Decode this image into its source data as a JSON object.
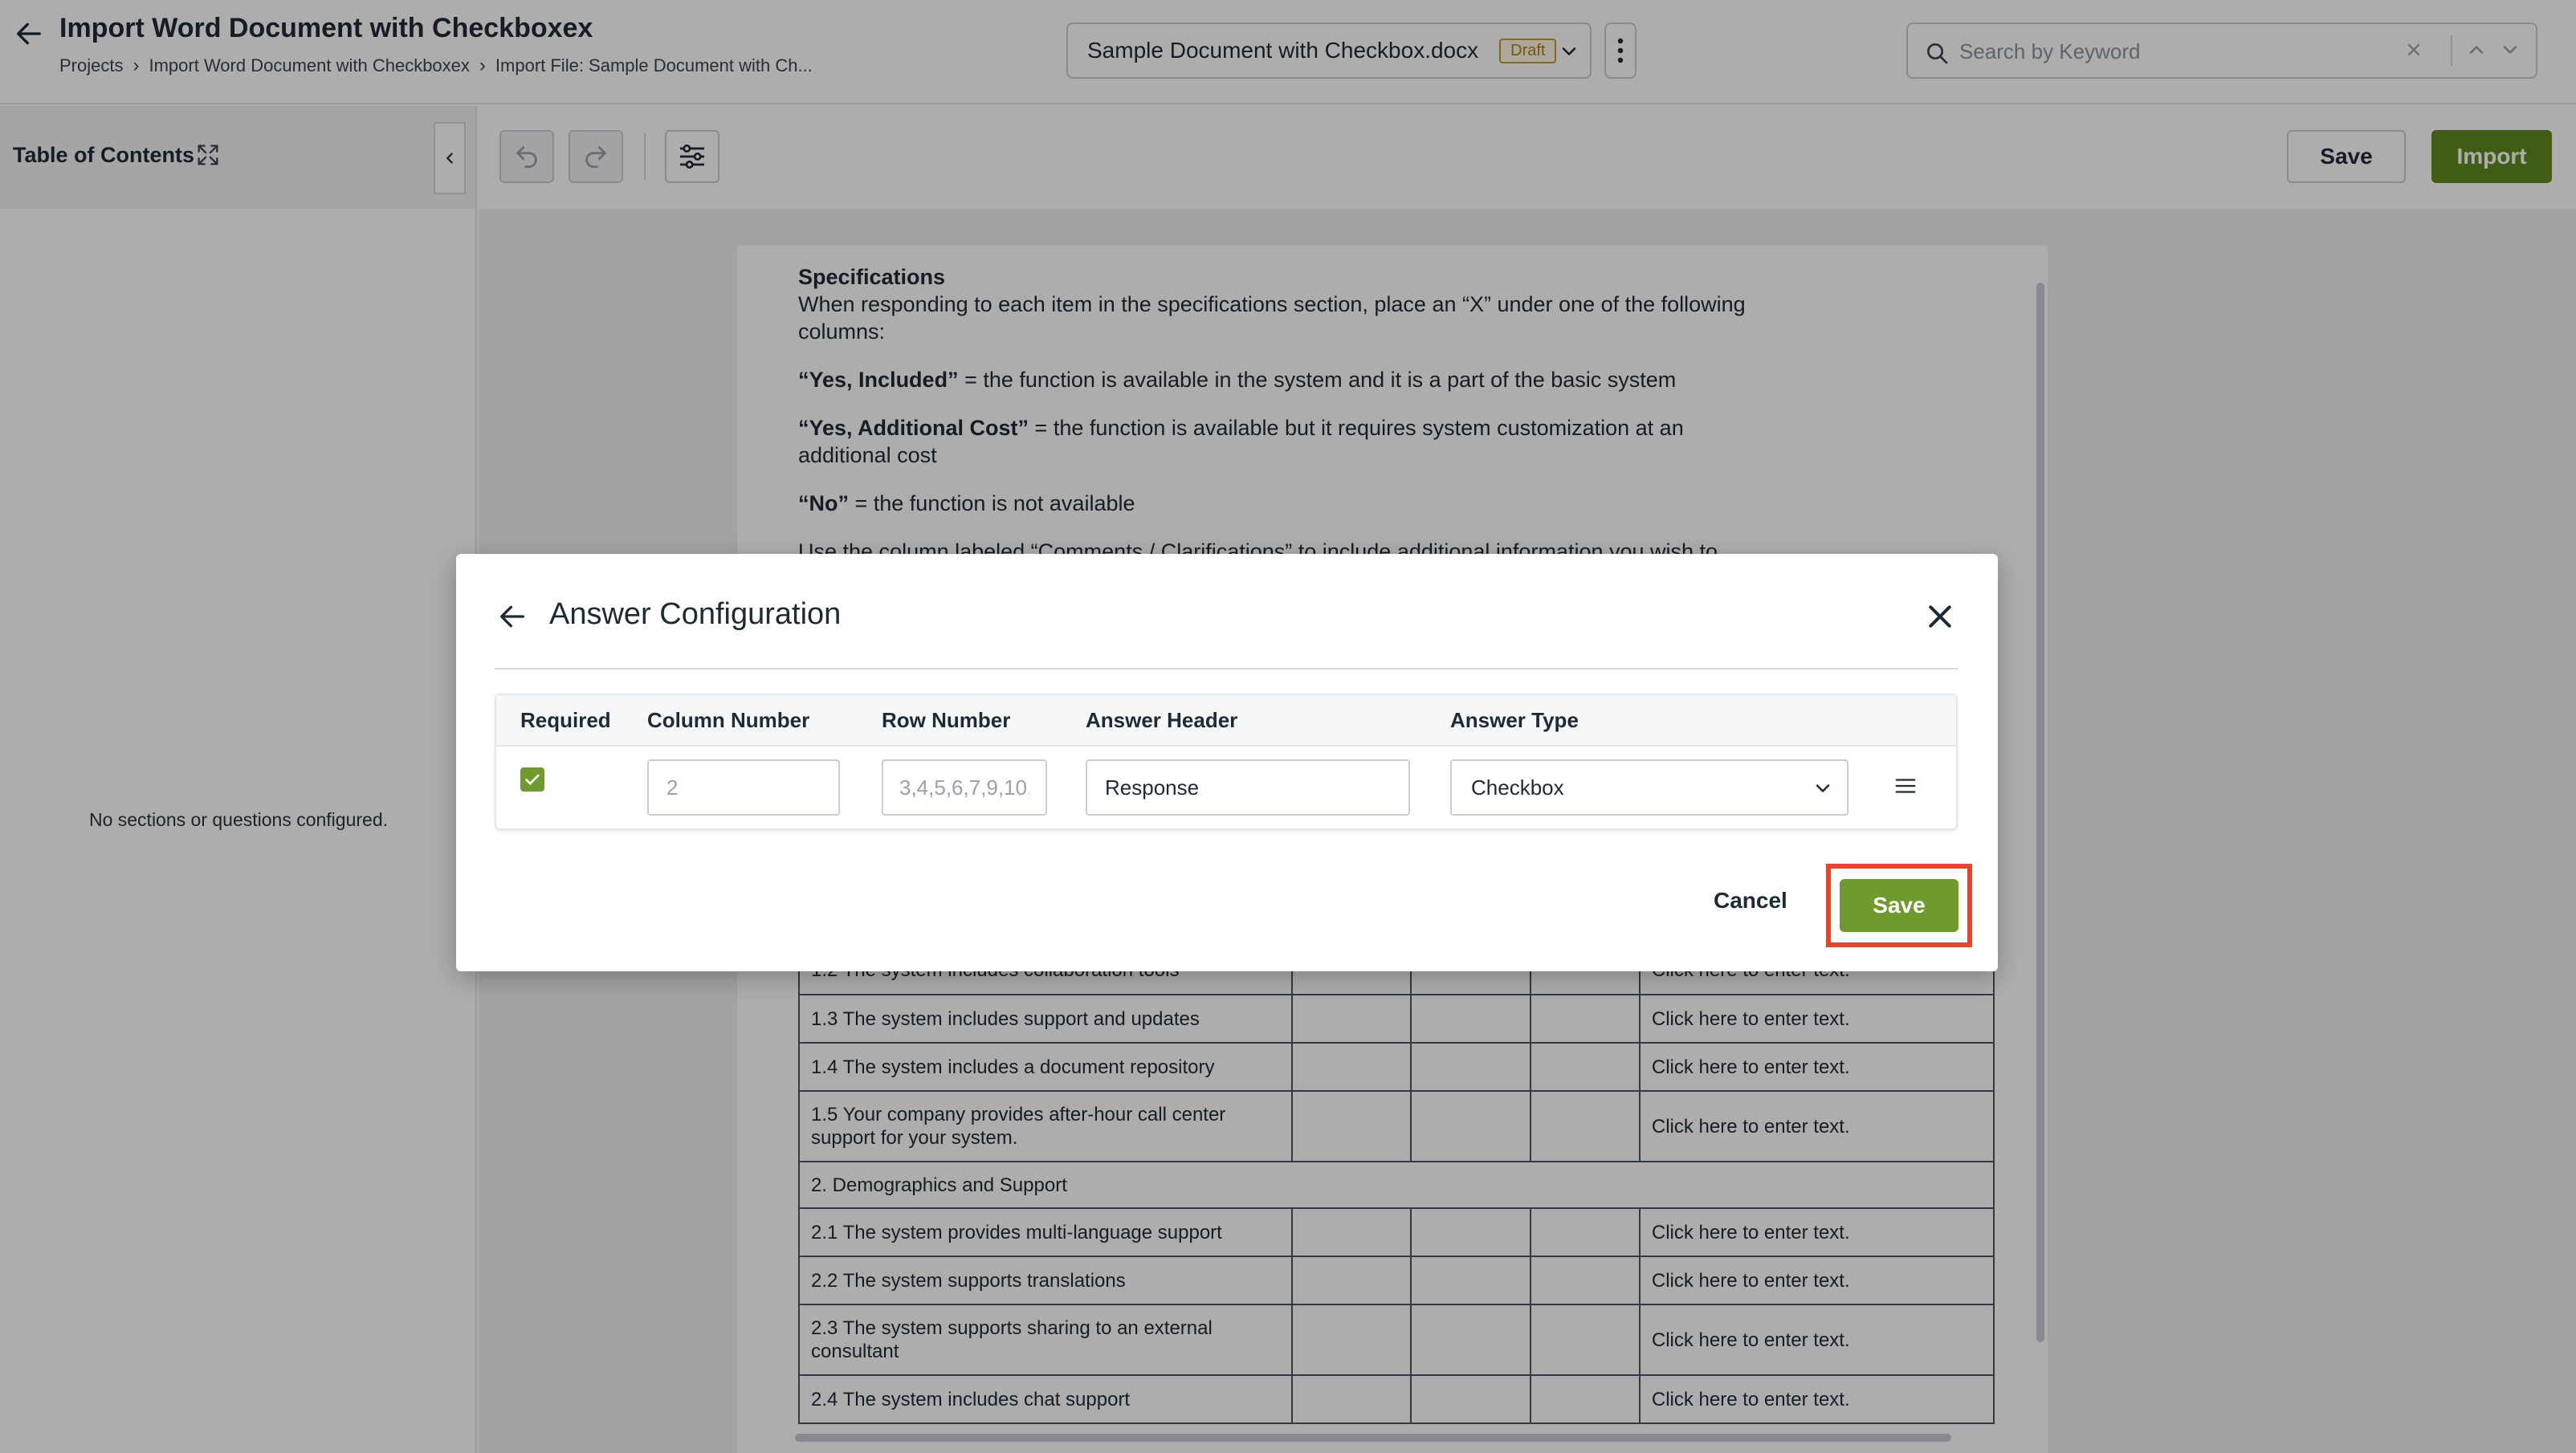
{
  "header": {
    "title": "Import Word Document with Checkboxex",
    "breadcrumb": [
      "Projects",
      "Import Word Document with Checkboxex",
      "Import File:  Sample Document with Ch..."
    ],
    "document_name": "Sample Document with Checkbox.docx",
    "draft_badge": "Draft",
    "search_placeholder": "Search by Keyword"
  },
  "toolbar": {
    "toc_title": "Table of Contents",
    "save_label": "Save",
    "import_label": "Import"
  },
  "sidebar": {
    "empty_message": "No sections or questions configured."
  },
  "document": {
    "spec_title": "Specifications",
    "intro": "When responding to each item in the specifications section, place an “X” under one of the following columns:",
    "yes_included_term": "“Yes, Included”",
    "yes_included_def": " = the function is available in the system and it is a part of the basic system",
    "yes_cost_term": "“Yes, Additional Cost”",
    "yes_cost_def": " = the function is available but it requires system customization at an additional cost",
    "no_term": "“No”",
    "no_def": " = the function is not available",
    "partial_line": "Use the column labeled “Comments / Clarifications” to include additional information you wish to",
    "comment_placeholder": "Click here to enter text.",
    "rows": [
      {
        "q": "1.2 The system includes collaboration tools",
        "comment": "Click here to enter text."
      },
      {
        "q": "1.3 The system includes support and updates",
        "comment": "Click here to enter text."
      },
      {
        "q": "1.4 The system includes a document repository",
        "comment": "Click here to enter text."
      },
      {
        "q": "1.5 Your company provides after-hour call center support for your system.",
        "comment": "Click here to enter text."
      },
      {
        "section": "2. Demographics and Support"
      },
      {
        "q": "2.1 The system provides multi-language support",
        "comment": "Click here to enter text."
      },
      {
        "q": "2.2 The system supports translations",
        "comment": "Click here to enter text."
      },
      {
        "q": "2.3 The system supports sharing to an external consultant",
        "comment": "Click here to enter text."
      },
      {
        "q": "2.4 The system includes chat support",
        "comment": "Click here to enter text."
      }
    ]
  },
  "modal": {
    "title": "Answer Configuration",
    "columns": [
      "Required",
      "Column Number",
      "Row Number",
      "Answer Header",
      "Answer Type"
    ],
    "row": {
      "required": true,
      "column_number_placeholder": "2",
      "row_number_placeholder": "3,4,5,6,7,9,10,",
      "answer_header_value": "Response",
      "answer_type": "Checkbox"
    },
    "cancel_label": "Cancel",
    "save_label": "Save"
  },
  "colors": {
    "accent_green": "#5f8a1c",
    "checkbox_green": "#6e9a2e",
    "highlight_red": "#e8432b",
    "draft_amber": "#c99a2e"
  }
}
